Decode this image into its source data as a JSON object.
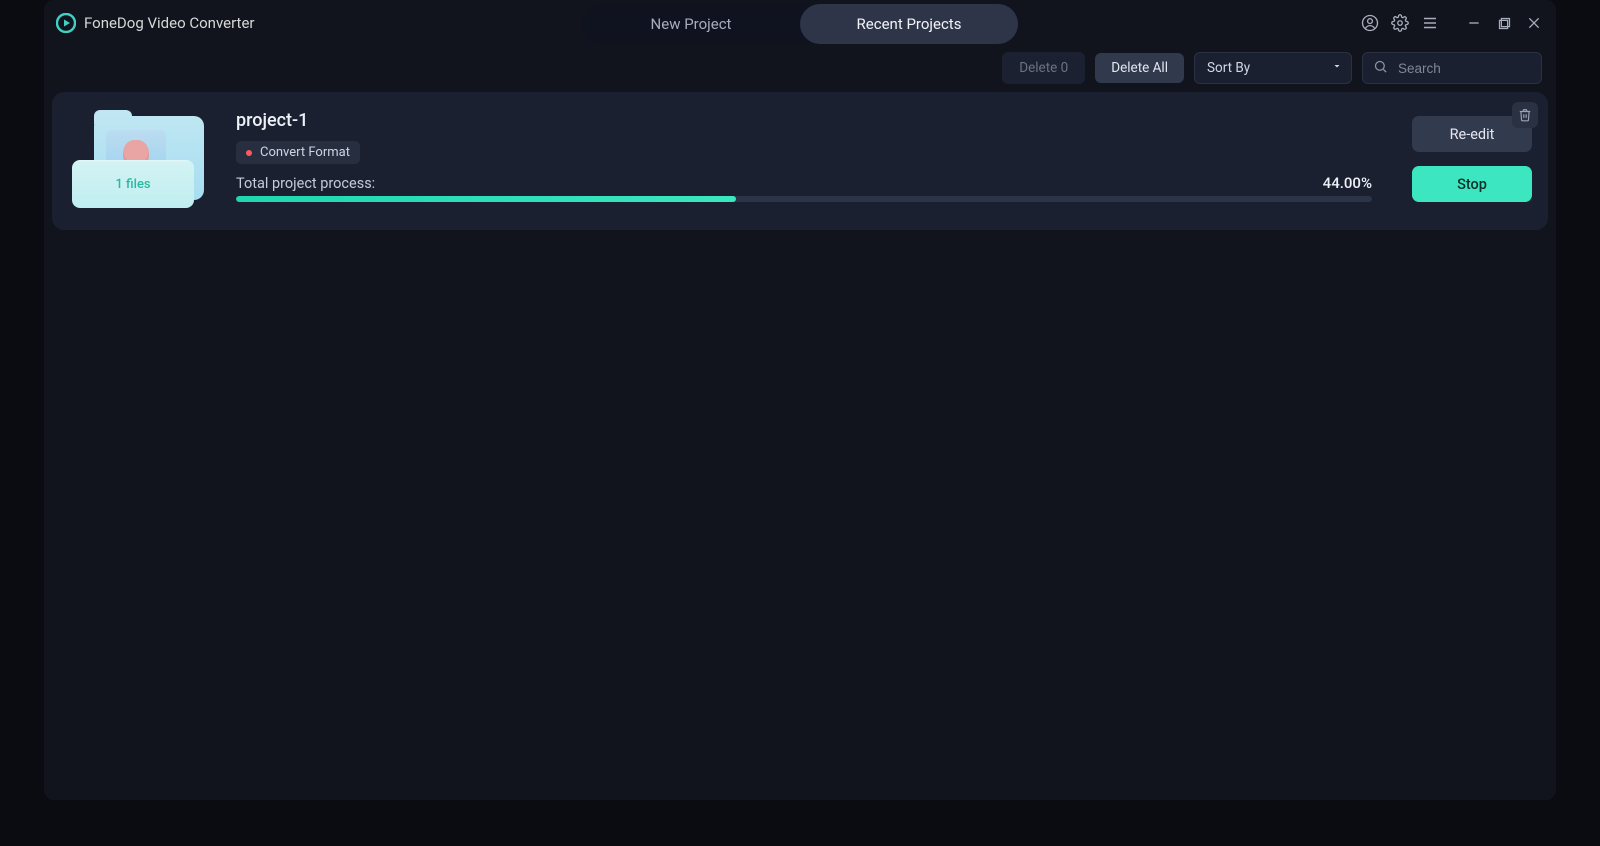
{
  "app": {
    "title": "FoneDog Video Converter"
  },
  "tabs": {
    "new_project": "New Project",
    "recent_projects": "Recent Projects"
  },
  "toolbar": {
    "delete0": "Delete 0",
    "delete_all": "Delete All",
    "sort_by": "Sort By",
    "search_placeholder": "Search"
  },
  "project": {
    "name": "project-1",
    "files_badge": "1 files",
    "tag": "Convert Format",
    "progress_label": "Total project process:",
    "progress_pct_text": "44.00%",
    "progress_pct_value": 44,
    "reedit": "Re-edit",
    "stop": "Stop"
  }
}
